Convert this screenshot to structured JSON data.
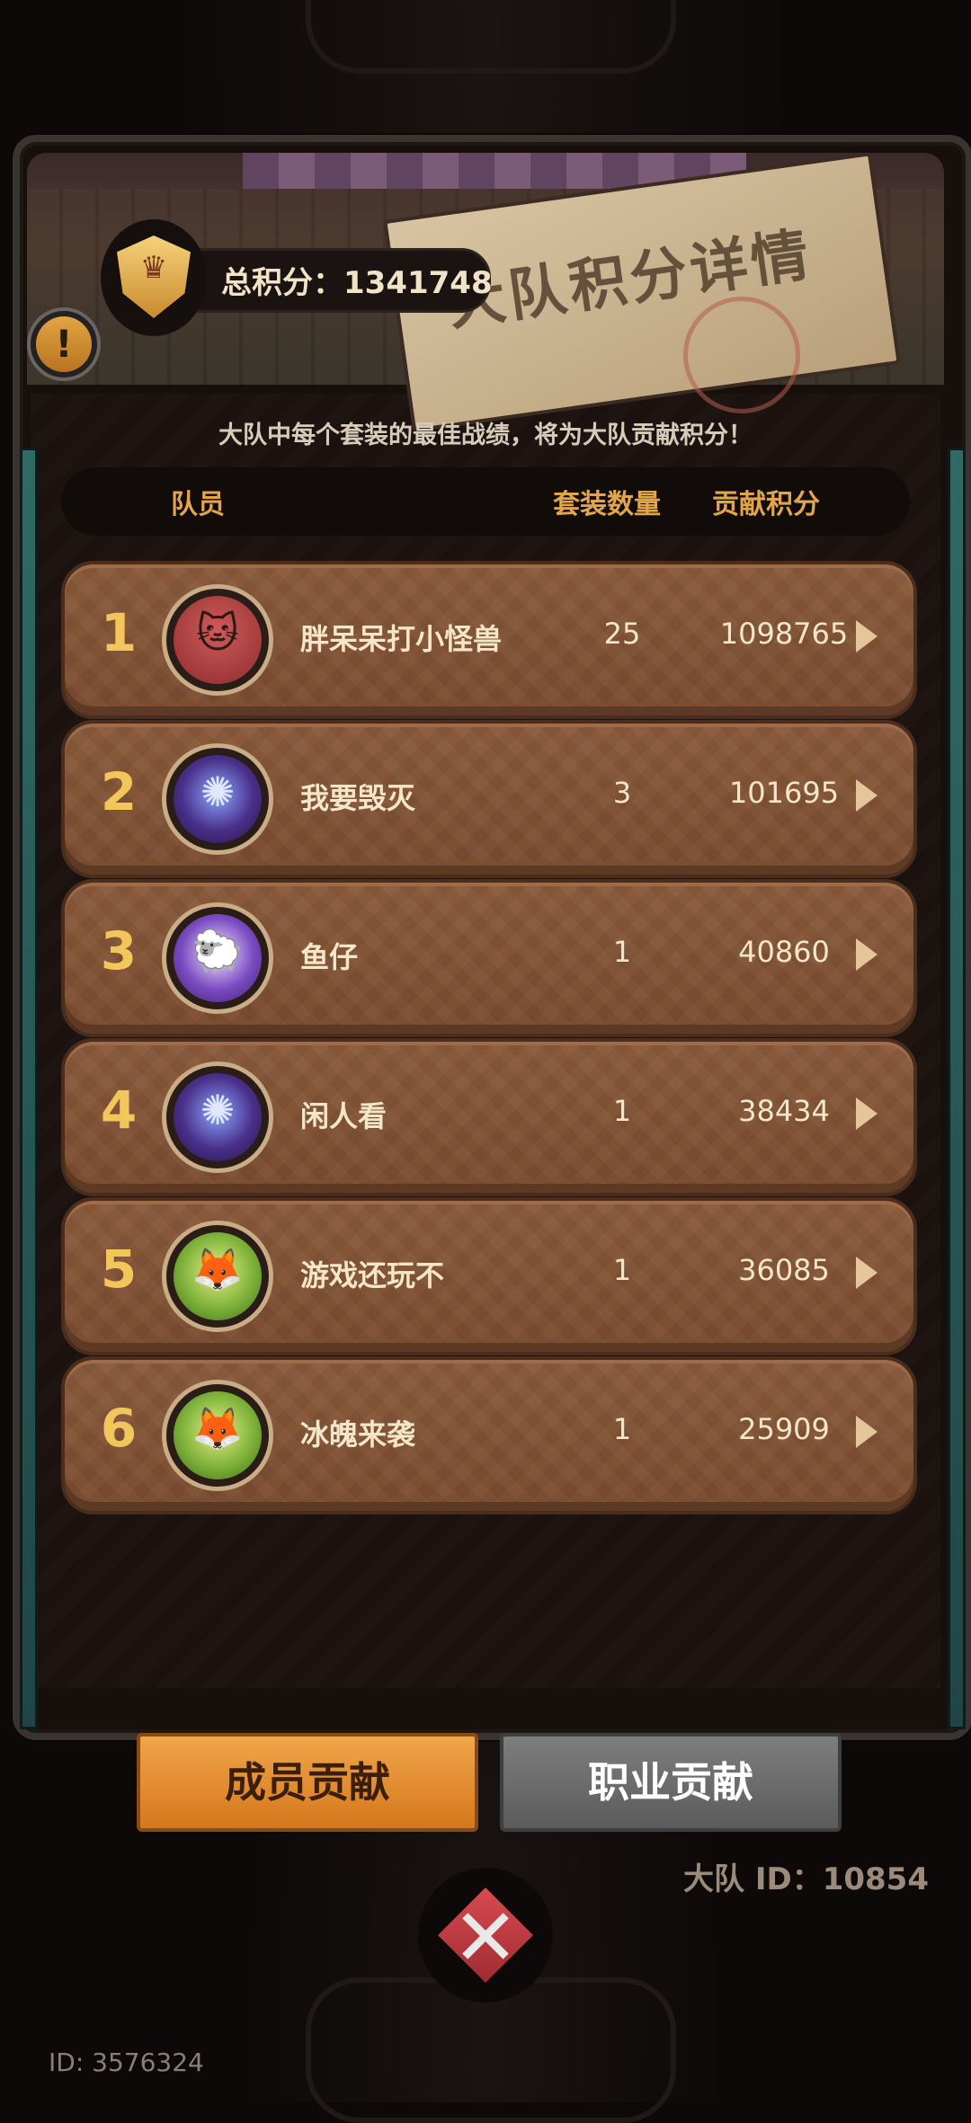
{
  "banner": {
    "title": "大队积分详情",
    "total_score_label": "总积分：1341748"
  },
  "subtitle": "大队中每个套装的最佳战绩，将为大队贡献积分！",
  "table": {
    "headers": {
      "member": "队员",
      "sets": "套装数量",
      "score": "贡献积分"
    },
    "rows": [
      {
        "rank": "1",
        "name": "胖呆呆打小怪兽",
        "sets": "25",
        "score": "1098765",
        "avatar": "cat-avatar"
      },
      {
        "rank": "2",
        "name": "我要毁灭",
        "sets": "3",
        "score": "101695",
        "avatar": "magic-orb-avatar"
      },
      {
        "rank": "3",
        "name": "鱼仔",
        "sets": "1",
        "score": "40860",
        "avatar": "sheep-avatar"
      },
      {
        "rank": "4",
        "name": "闲人看",
        "sets": "1",
        "score": "38434",
        "avatar": "magic-orb-avatar"
      },
      {
        "rank": "5",
        "name": "游戏还玩不",
        "sets": "1",
        "score": "36085",
        "avatar": "fox-avatar"
      },
      {
        "rank": "6",
        "name": "冰魄来袭",
        "sets": "1",
        "score": "25909",
        "avatar": "fox-avatar"
      }
    ]
  },
  "tabs": {
    "member": "成员贡献",
    "class": "职业贡献"
  },
  "squad_id": "大队 ID：10854",
  "user_id": "ID: 3576324",
  "colors": {
    "accent_gold": "#e2a54a",
    "row_brown": "#7a4c30",
    "active_tab": "#f1a54a",
    "inactive_tab": "#6b6b6b",
    "close_red": "#c23a3f"
  }
}
